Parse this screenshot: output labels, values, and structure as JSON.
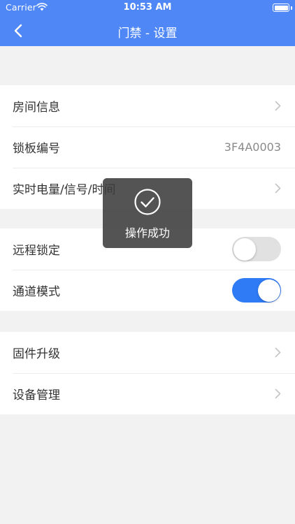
{
  "status_bar": {
    "carrier": "Carrier",
    "time": "10:53 AM"
  },
  "nav": {
    "title": "门禁 - 设置",
    "back_icon": "chevron-left-icon"
  },
  "groups": [
    {
      "rows": [
        {
          "label": "房间信息",
          "type": "link"
        },
        {
          "label": "锁板编号",
          "type": "value",
          "value": "3F4A0003"
        },
        {
          "label": "实时电量/信号/时间",
          "type": "link"
        }
      ]
    },
    {
      "rows": [
        {
          "label": "远程锁定",
          "type": "toggle",
          "on": false
        },
        {
          "label": "通道模式",
          "type": "toggle",
          "on": true
        }
      ]
    },
    {
      "rows": [
        {
          "label": "固件升级",
          "type": "link"
        },
        {
          "label": "设备管理",
          "type": "link"
        }
      ]
    }
  ],
  "toast": {
    "icon": "checkmark-circle-icon",
    "text": "操作成功"
  },
  "colors": {
    "header": "#4f87f7",
    "toggle_on": "#2f7bf6",
    "toggle_off": "#e1e1e1",
    "background": "#f2f2f2"
  }
}
